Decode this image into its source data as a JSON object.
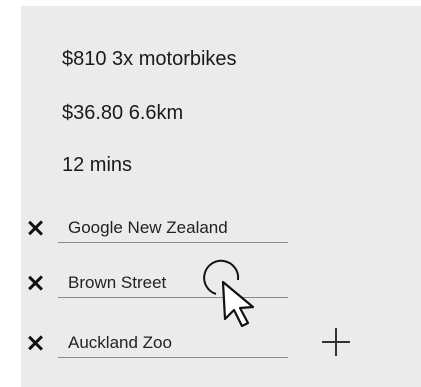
{
  "summary": {
    "cost_and_vehicles": "$810 3x motorbikes",
    "fare_and_distance": "$36.80 6.6km",
    "duration": "12 mins"
  },
  "stops": [
    {
      "name": "Google New Zealand"
    },
    {
      "name": "Brown Street"
    },
    {
      "name": "Auckland Zoo"
    }
  ],
  "icons": {
    "remove": "close-icon",
    "add": "plus-icon",
    "cursor": "click-cursor-icon"
  },
  "colors": {
    "panel_background": "#ebebeb",
    "text": "#1a1a1a",
    "underline": "#8a8a8a"
  }
}
